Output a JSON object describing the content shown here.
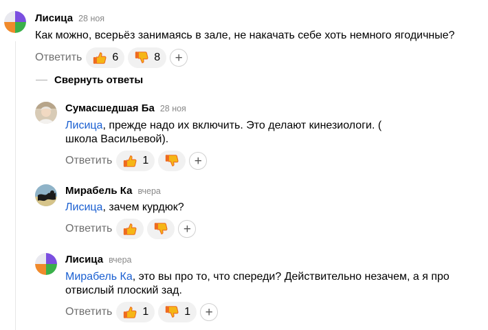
{
  "comments": [
    {
      "author": "Лисица",
      "date": "28 ноя",
      "text": "Как можно, всерьёз занимаясь в зале, не накачать себе хоть немного ягодичные?",
      "reply_label": "Ответить",
      "likes": "6",
      "dislikes": "8"
    },
    {
      "author": "Сумасшедшая Ба",
      "date": "28 ноя",
      "mention": "Лисица",
      "text": ", прежде надо их включить. Это делают кинезиологи. ( школа Васильевой).",
      "reply_label": "Ответить",
      "likes": "1",
      "dislikes": ""
    },
    {
      "author": "Мирабель Ка",
      "date": "вчера",
      "mention": "Лисица",
      "text": ", зачем курдюк?",
      "reply_label": "Ответить",
      "likes": "",
      "dislikes": ""
    },
    {
      "author": "Лисица",
      "date": "вчера",
      "mention": "Мирабель Ка",
      "text": ", это вы про то, что спереди? Действительно незачем, а я про отвислый плоский зад.",
      "reply_label": "Ответить",
      "likes": "1",
      "dislikes": "1"
    }
  ],
  "collapse_label": "Свернуть ответы",
  "add_reaction_symbol": "+",
  "icons": {
    "like": "thumbs-up-icon",
    "dislike": "thumbs-down-icon",
    "add": "plus-icon"
  },
  "colors": {
    "mention": "#1a5fd1",
    "reaction_bg": "#f1f1f1",
    "reply_text": "#6f6f6f",
    "emoji_yellow": "#f5b616",
    "emoji_orange": "#ee6a1f"
  }
}
